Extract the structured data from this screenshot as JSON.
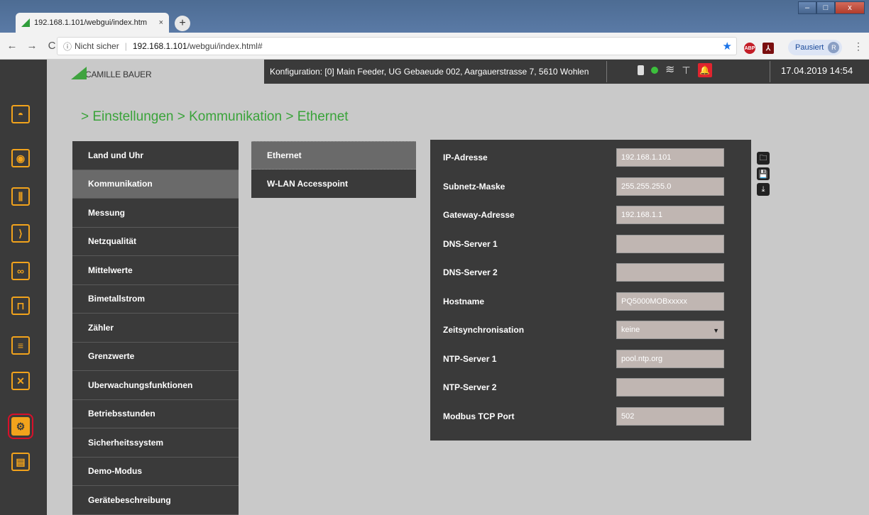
{
  "browser": {
    "tab_title": "192.168.1.101/webgui/index.htm",
    "tab_close": "×",
    "new_tab": "+",
    "nav_back": "←",
    "nav_forward": "→",
    "nav_reload": "C",
    "security_label": "Nicht sicher",
    "url_host": "192.168.1.101",
    "url_path": "/webgui/index.html#",
    "star": "★",
    "ext_abp": "ABP",
    "ext_pdf": "⅄",
    "profile_label": "Pausiert",
    "profile_initial": "R",
    "menu": "⋮",
    "win_min": "–",
    "win_max": "□",
    "win_close": "x"
  },
  "header": {
    "logo_text": "CAMILLE BAUER",
    "config": "Konfiguration: [0] Main Feeder, UG Gebaeude 002, Aargauerstrasse 7, 5610 Wohlen",
    "datetime": "17.04.2019  14:54",
    "wifi": "≋",
    "network": "⊤",
    "bell": "🔔"
  },
  "sidebar_icons": [
    {
      "name": "dashboard-icon",
      "glyph": "◓"
    },
    {
      "name": "meter-icon",
      "glyph": "◉"
    },
    {
      "name": "bar-chart-icon",
      "glyph": "⫼"
    },
    {
      "name": "phasor-icon",
      "glyph": "⟩"
    },
    {
      "name": "waveform-icon",
      "glyph": "∞"
    },
    {
      "name": "event-icon",
      "glyph": "⊓"
    },
    {
      "name": "list-icon",
      "glyph": "≡"
    },
    {
      "name": "tools-icon",
      "glyph": "✕"
    },
    {
      "name": "settings-icon",
      "glyph": "⚙"
    },
    {
      "name": "report-icon",
      "glyph": "▤"
    }
  ],
  "breadcrumb": "> Einstellungen > Kommunikation > Ethernet",
  "menu": [
    "Land und Uhr",
    "Kommunikation",
    "Messung",
    "Netzqualität",
    "Mittelwerte",
    "Bimetallstrom",
    "Zähler",
    "Grenzwerte",
    "Uberwachungsfunktionen",
    "Betriebsstunden",
    "Sicherheitssystem",
    "Demo-Modus",
    "Gerätebeschreibung"
  ],
  "submenu": [
    "Ethernet",
    "W-LAN Accesspoint"
  ],
  "form": [
    {
      "label": "IP-Adresse",
      "value": "192.168.1.101"
    },
    {
      "label": "Subnetz-Maske",
      "value": "255.255.255.0"
    },
    {
      "label": "Gateway-Adresse",
      "value": "192.168.1.1"
    },
    {
      "label": "DNS-Server 1",
      "value": ""
    },
    {
      "label": "DNS-Server 2",
      "value": ""
    },
    {
      "label": "Hostname",
      "value": "PQ5000MOBxxxxx"
    },
    {
      "label": "Zeitsynchronisation",
      "value": "keine",
      "arrow": "▼"
    },
    {
      "label": "NTP-Server 1",
      "value": "pool.ntp.org"
    },
    {
      "label": "NTP-Server 2",
      "value": ""
    },
    {
      "label": "Modbus TCP Port",
      "value": "502"
    }
  ],
  "tools": {
    "open": "🗀",
    "save": "💾",
    "download": "⤓"
  }
}
